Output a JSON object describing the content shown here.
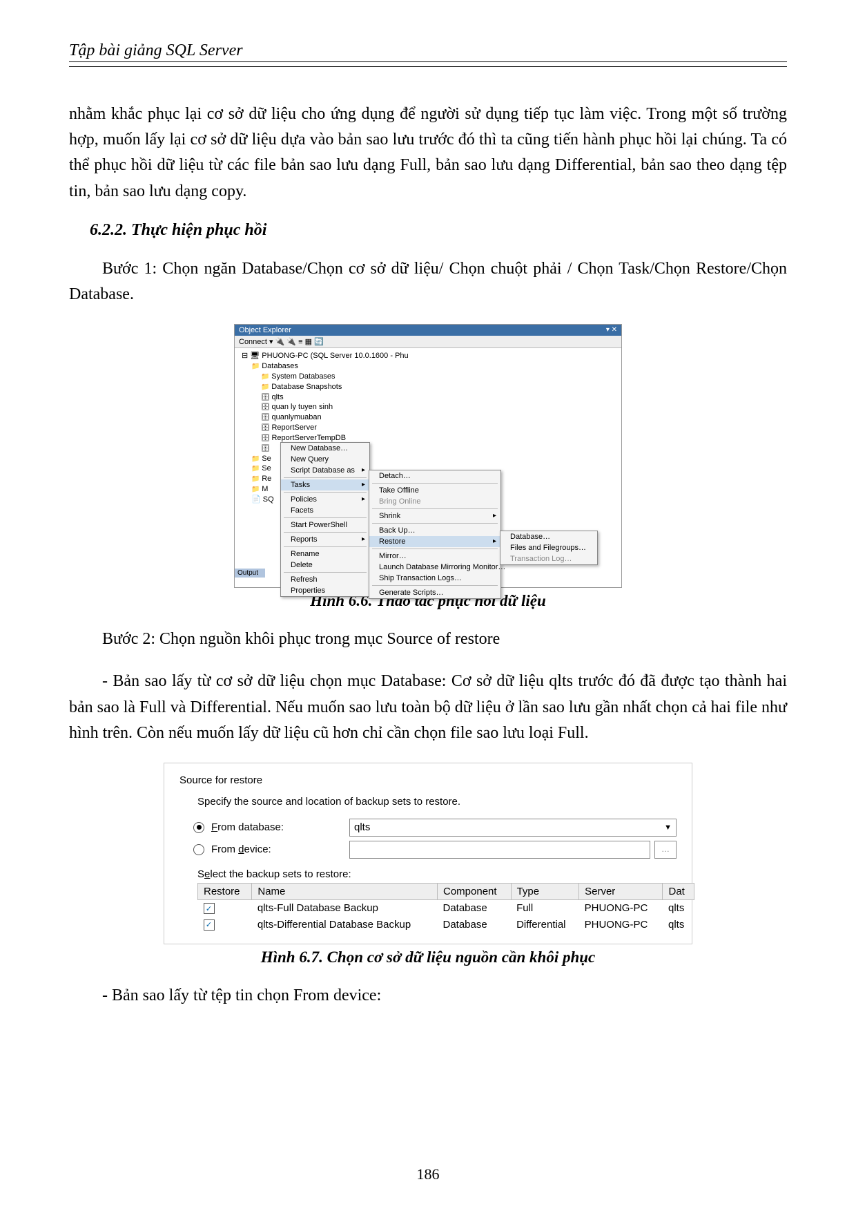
{
  "header": {
    "title": "Tập bài giảng SQL Server"
  },
  "paragraphs": {
    "p1": "nhằm khắc phục lại cơ sở dữ liệu cho ứng dụng để người sử dụng tiếp tục làm việc. Trong một số trường hợp, muốn lấy lại cơ sở dữ liệu dựa vào bản sao lưu trước đó thì ta cũng tiến hành phục hồi lại chúng. Ta có thể phục hồi dữ liệu từ các file bản sao lưu dạng Full,  bản sao lưu dạng Differential, bản sao theo dạng tệp tin, bản sao lưu dạng copy.",
    "subheading": "6.2.2. Thực hiện phục hồi",
    "step1": "Bước 1: Chọn ngăn Database/Chọn cơ sở dữ liệu/ Chọn chuột phải / Chọn Task/Chọn Restore/Chọn Database.",
    "caption66": "Hình 6.6. Thao tác phục hồi dữ liệu",
    "step2": "Bước 2: Chọn nguồn khôi phục trong mục Source of restore",
    "p2": "- Bản sao lấy từ cơ sở dữ liệu chọn mục Database: Cơ sở dữ liệu qlts trước đó đã được tạo thành hai bản sao là Full và Differential. Nếu muốn sao lưu toàn bộ dữ liệu ở lần sao lưu gần nhất chọn cả hai file như hình trên. Còn nếu muốn lấy dữ liệu cũ hơn chỉ cần chọn file sao lưu loại Full.",
    "caption67": "Hình 6.7. Chọn cơ sở dữ liệu nguồn cần khôi phục",
    "p3": "- Bản sao lấy từ tệp tin  chọn From device:"
  },
  "fig66": {
    "explorerTitle": "Object Explorer",
    "connect": "Connect ▾",
    "server": "PHUONG-PC (SQL Server 10.0.1600 - Phu",
    "nodes": {
      "databases": "Databases",
      "sysdb": "System Databases",
      "snap": "Database Snapshots",
      "qlts": "qlts",
      "quanly": "quan ly tuyen sinh",
      "quanlymuaban": "quanlymuaban",
      "reportserver": "ReportServer",
      "reportservertemp": "ReportServerTempDB",
      "se": "Se",
      "se2": "Se",
      "re": "Re",
      "m": "M",
      "sq": "SQ"
    },
    "output": "Output",
    "menu1": {
      "newdb": "New Database…",
      "newquery": "New Query",
      "script": "Script Database as",
      "tasks": "Tasks",
      "policies": "Policies",
      "facets": "Facets",
      "startps": "Start PowerShell",
      "reports": "Reports",
      "rename": "Rename",
      "delete": "Delete",
      "refresh": "Refresh",
      "properties": "Properties"
    },
    "menu2": {
      "detach": "Detach…",
      "takeoffline": "Take Offline",
      "bringonline": "Bring Online",
      "shrink": "Shrink",
      "backup": "Back Up…",
      "restore": "Restore",
      "mirror": "Mirror…",
      "launchmirror": "Launch Database Mirroring Monitor…",
      "shiplogs": "Ship Transaction Logs…",
      "genscripts": "Generate Scripts…"
    },
    "menu3": {
      "database": "Database…",
      "files": "Files and Filegroups…",
      "tlog": "Transaction Log…"
    }
  },
  "fig67": {
    "groupTitle": "Source for restore",
    "hint": "Specify the source and location of backup sets to restore.",
    "fromDbLabel": "From database:",
    "fromDbValue": "qlts",
    "fromDeviceLabel": "From device:",
    "selectBackup": "Select the backup sets to restore:",
    "headers": {
      "restore": "Restore",
      "name": "Name",
      "component": "Component",
      "type": "Type",
      "server": "Server",
      "database": "Dat"
    },
    "rows": [
      {
        "name": "qlts-Full Database Backup",
        "component": "Database",
        "type": "Full",
        "server": "PHUONG-PC",
        "db": "qlts"
      },
      {
        "name": "qlts-Differential Database Backup",
        "component": "Database",
        "type": "Differential",
        "server": "PHUONG-PC",
        "db": "qlts"
      }
    ]
  },
  "pageNumber": "186"
}
